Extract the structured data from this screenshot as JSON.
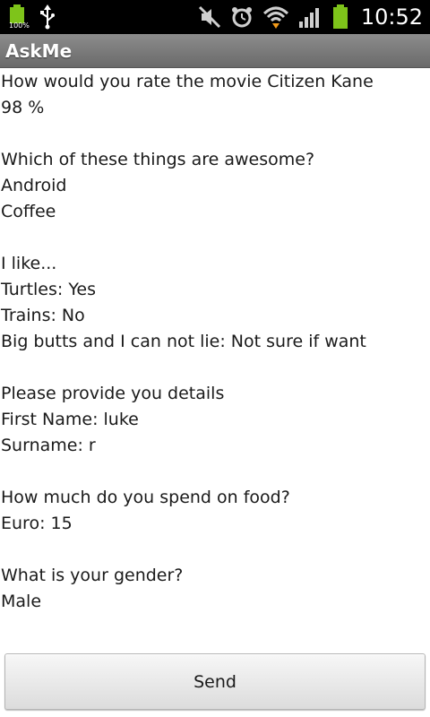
{
  "status_bar": {
    "battery_label": "100%",
    "time": "10:52",
    "icons": [
      "battery-icon",
      "usb-icon",
      "mute-icon",
      "alarm-icon",
      "wifi-icon",
      "signal-icon",
      "battery-icon"
    ],
    "battery_color": "#7ec41a"
  },
  "app_bar": {
    "title": "AskMe"
  },
  "answers": {
    "q1": "How would you rate the movie Citizen Kane",
    "q1_a1": "98 %",
    "q2": "Which of these things are awesome?",
    "q2_a1": "Android",
    "q2_a2": "Coffee",
    "q3": "I like...",
    "q3_a1": "Turtles: Yes",
    "q3_a2": "Trains: No",
    "q3_a3": "Big butts and I can not lie: Not sure if want",
    "q4": "Please provide you details",
    "q4_a1": "First Name: luke",
    "q4_a2": "Surname: r",
    "q5": "How much do you spend on food?",
    "q5_a1": "Euro: 15",
    "q6": "What is your gender?",
    "q6_a1": "Male"
  },
  "actions": {
    "send_label": "Send"
  }
}
